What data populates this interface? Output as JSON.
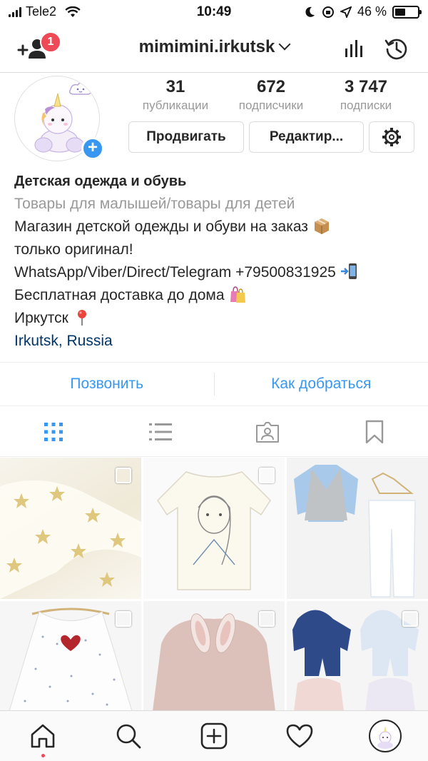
{
  "status_bar": {
    "carrier": "Tele2",
    "time": "10:49",
    "battery_percent": "46 %",
    "battery_level": 0.46
  },
  "header": {
    "username": "mimimini.irkutsk",
    "notification_count": "1"
  },
  "profile": {
    "stats": [
      {
        "value": "31",
        "label": "публикации"
      },
      {
        "value": "672",
        "label": "подписчики"
      },
      {
        "value": "3 747",
        "label": "подписки"
      }
    ],
    "buttons": {
      "promote": "Продвигать",
      "edit": "Редактир..."
    }
  },
  "bio": {
    "name": "Детская одежда и обувь",
    "category": "Товары для малышей/товары для детей",
    "line1": "Магазин детской одежды и обуви на заказ",
    "line2": "только оригинал!",
    "line3": "WhatsApp/Viber/Direct/Telegram +79500831925",
    "line4": "Бесплатная доставка до дома",
    "line5": "Иркутск",
    "location": "Irkutsk, Russia"
  },
  "actions": {
    "call": "Позвонить",
    "directions": "Как добраться"
  },
  "tabs": [
    "grid-icon",
    "list-icon",
    "tagged-icon",
    "saved-icon"
  ],
  "posts": [
    {
      "label": "white tights with gold stars",
      "multi": true
    },
    {
      "label": "Frozen Elsa long sleeve top",
      "multi": true
    },
    {
      "label": "grey vest and white pants outfit",
      "multi": false
    },
    {
      "label": "polka dot dress with heart",
      "multi": true
    },
    {
      "label": "pink fur coat with bunny ears",
      "multi": true
    },
    {
      "label": "winter overalls",
      "multi": true
    }
  ],
  "bottom_nav": [
    "home-icon",
    "search-icon",
    "new-post-icon",
    "activity-icon",
    "profile-avatar"
  ],
  "colors": {
    "accent": "#3897f0",
    "badge": "#ed4956",
    "location_link": "#003569"
  }
}
